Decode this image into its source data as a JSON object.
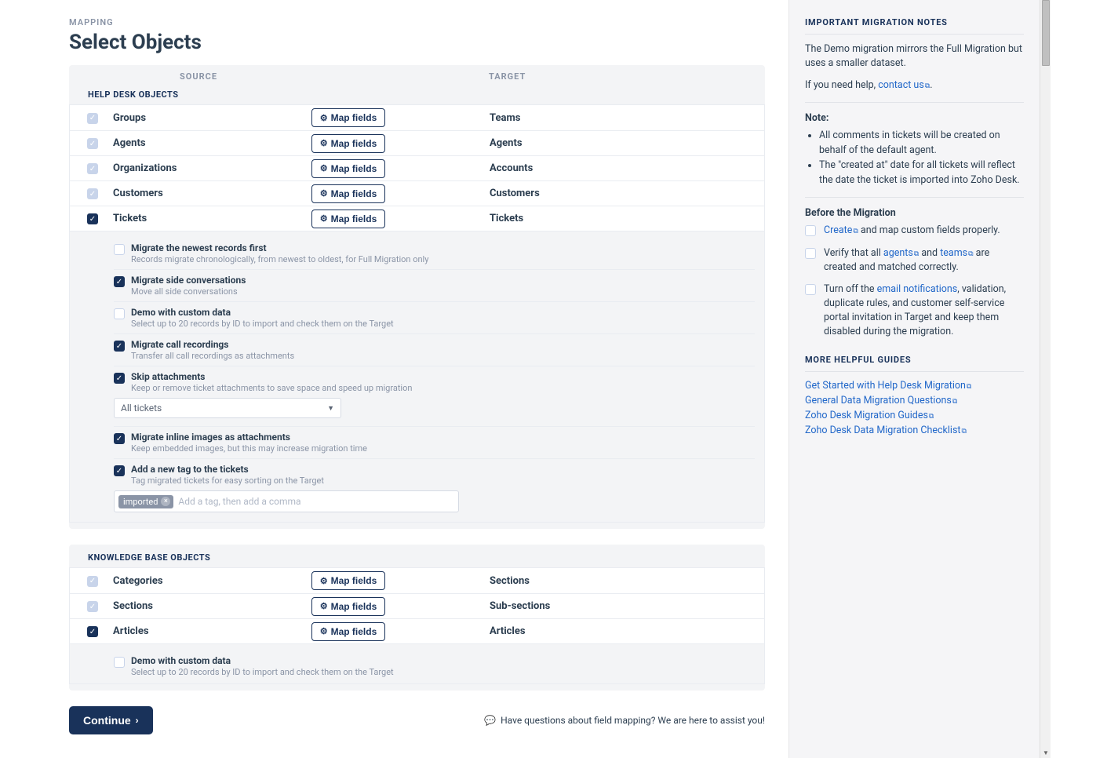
{
  "breadcrumb": "MAPPING",
  "page_title": "Select Objects",
  "columns": {
    "source": "SOURCE",
    "target": "TARGET"
  },
  "map_fields_label": "Map fields",
  "sections": {
    "helpdesk_title": "HELP DESK OBJECTS",
    "kb_title": "KNOWLEDGE BASE OBJECTS"
  },
  "helpdesk": [
    {
      "source": "Groups",
      "target": "Teams",
      "locked": true
    },
    {
      "source": "Agents",
      "target": "Agents",
      "locked": true
    },
    {
      "source": "Organizations",
      "target": "Accounts",
      "locked": true
    },
    {
      "source": "Customers",
      "target": "Customers",
      "locked": true
    },
    {
      "source": "Tickets",
      "target": "Tickets",
      "locked": false,
      "checked": true
    }
  ],
  "ticket_options": [
    {
      "key": "newest_first",
      "checked": false,
      "title": "Migrate the newest records first",
      "desc": "Records migrate chronologically, from newest to oldest, for Full Migration only"
    },
    {
      "key": "side_convos",
      "checked": true,
      "title": "Migrate side conversations",
      "desc": "Move all side conversations"
    },
    {
      "key": "demo_custom",
      "checked": false,
      "title": "Demo with custom data",
      "desc": "Select up to 20 records by ID to import and check them on the Target"
    },
    {
      "key": "call_rec",
      "checked": true,
      "title": "Migrate call recordings",
      "desc": "Transfer all call recordings as attachments"
    },
    {
      "key": "skip_attach",
      "checked": true,
      "title": "Skip attachments",
      "desc": "Keep or remove ticket attachments to save space and speed up migration",
      "select": "All tickets"
    },
    {
      "key": "inline_img",
      "checked": true,
      "title": "Migrate inline images as attachments",
      "desc": "Keep embedded images, but this may increase migration time"
    },
    {
      "key": "add_tag",
      "checked": true,
      "title": "Add a new tag to the tickets",
      "desc": "Tag migrated tickets for easy sorting on the Target",
      "tag": "imported",
      "placeholder": "Add a tag, then add a comma"
    }
  ],
  "kb": [
    {
      "source": "Categories",
      "target": "Sections",
      "locked": true
    },
    {
      "source": "Sections",
      "target": "Sub-sections",
      "locked": true
    },
    {
      "source": "Articles",
      "target": "Articles",
      "locked": false,
      "checked": true
    }
  ],
  "article_options": [
    {
      "key": "demo_custom_kb",
      "checked": false,
      "title": "Demo with custom data",
      "desc": "Select up to 20 records by ID to import and check them on the Target"
    }
  ],
  "continue_label": "Continue",
  "help_prompt": "Have questions about field mapping? We are here to assist you!",
  "sidebar": {
    "notes_header": "IMPORTANT MIGRATION NOTES",
    "intro": "The Demo migration mirrors the Full Migration but uses a smaller dataset.",
    "help_prefix": "If you need help, ",
    "contact_us": "contact us",
    "note_label": "Note:",
    "notes": [
      "All comments in tickets will be created on behalf of the default agent.",
      "The \"created at\" date for all tickets will reflect the date the ticket is imported into Zoho Desk."
    ],
    "before_header": "Before the Migration",
    "checklist": [
      {
        "prefix": "",
        "link1": "Create",
        "mid1": " and map custom fields properly."
      },
      {
        "prefix": "Verify that all ",
        "link1": "agents",
        "mid1": " and ",
        "link2": "teams",
        "mid2": " are created and matched correctly."
      },
      {
        "prefix": "Turn off the ",
        "link1": "email notifications",
        "mid1": ", validation, duplicate rules, and customer self-service portal invitation in Target and keep them disabled during the migration."
      }
    ],
    "guides_header": "MORE HELPFUL GUIDES",
    "guides": [
      "Get Started with Help Desk Migration",
      "General Data Migration Questions",
      "Zoho Desk Migration Guides",
      "Zoho Desk Data Migration Checklist"
    ]
  }
}
